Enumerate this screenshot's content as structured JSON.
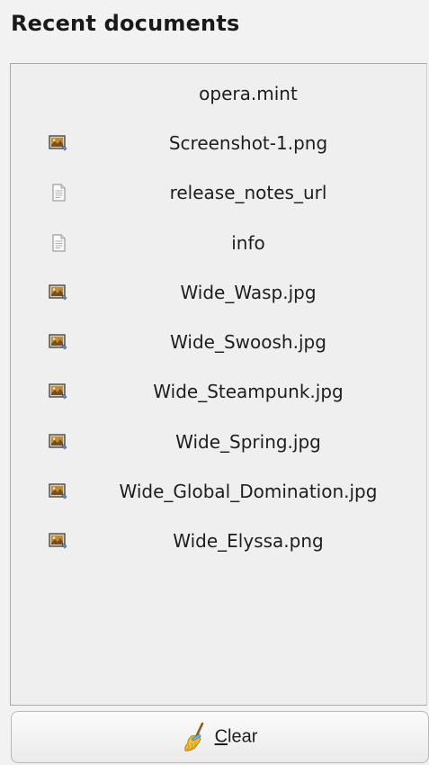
{
  "header": {
    "title": "Recent documents"
  },
  "documents": [
    {
      "name": "opera.mint",
      "icon": "blank-icon"
    },
    {
      "name": "Screenshot-1.png",
      "icon": "image-file-icon"
    },
    {
      "name": "release_notes_url",
      "icon": "text-file-icon"
    },
    {
      "name": "info",
      "icon": "text-file-icon"
    },
    {
      "name": "Wide_Wasp.jpg",
      "icon": "image-file-icon"
    },
    {
      "name": "Wide_Swoosh.jpg",
      "icon": "image-file-icon"
    },
    {
      "name": "Wide_Steampunk.jpg",
      "icon": "image-file-icon"
    },
    {
      "name": "Wide_Spring.jpg",
      "icon": "image-file-icon"
    },
    {
      "name": "Wide_Global_Domination.jpg",
      "icon": "image-file-icon"
    },
    {
      "name": "Wide_Elyssa.png",
      "icon": "image-file-icon"
    }
  ],
  "clear_button": {
    "mnemonic": "C",
    "label_rest": "lear",
    "icon": "broom-icon"
  },
  "colors": {
    "background": "#f2f2f2",
    "text": "#1e1e1e",
    "broom": "#e8b830"
  }
}
